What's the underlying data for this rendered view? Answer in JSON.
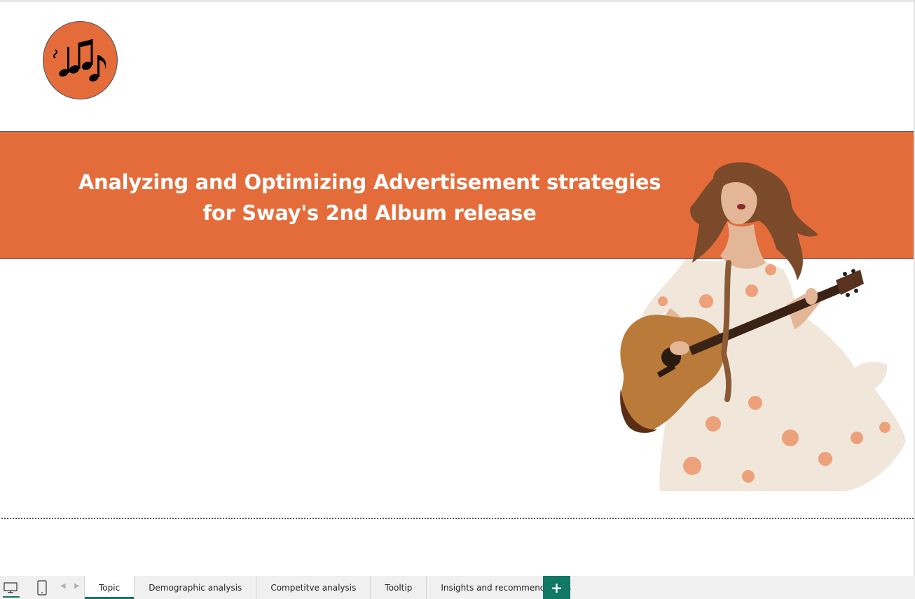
{
  "colors": {
    "accent": "#e46c3a",
    "brand": "#117865"
  },
  "report": {
    "title_line1": "Analyzing and Optimizing Advertisement strategies",
    "title_line2": "for Sway's 2nd Album release",
    "logo_icon": "music-notes-icon",
    "image": "singer-with-guitar"
  },
  "bottom_bar": {
    "view_buttons": [
      "desktop-view-icon",
      "mobile-view-icon"
    ],
    "nav": [
      "chevron-left-icon",
      "chevron-right-icon"
    ],
    "tabs": [
      {
        "label": "Topic",
        "active": true
      },
      {
        "label": "Demographic analysis",
        "active": false
      },
      {
        "label": "Competitve analysis",
        "active": false
      },
      {
        "label": "Tooltip",
        "active": false
      },
      {
        "label": "Insights and recommendations",
        "active": false
      }
    ],
    "add_label": "+"
  }
}
